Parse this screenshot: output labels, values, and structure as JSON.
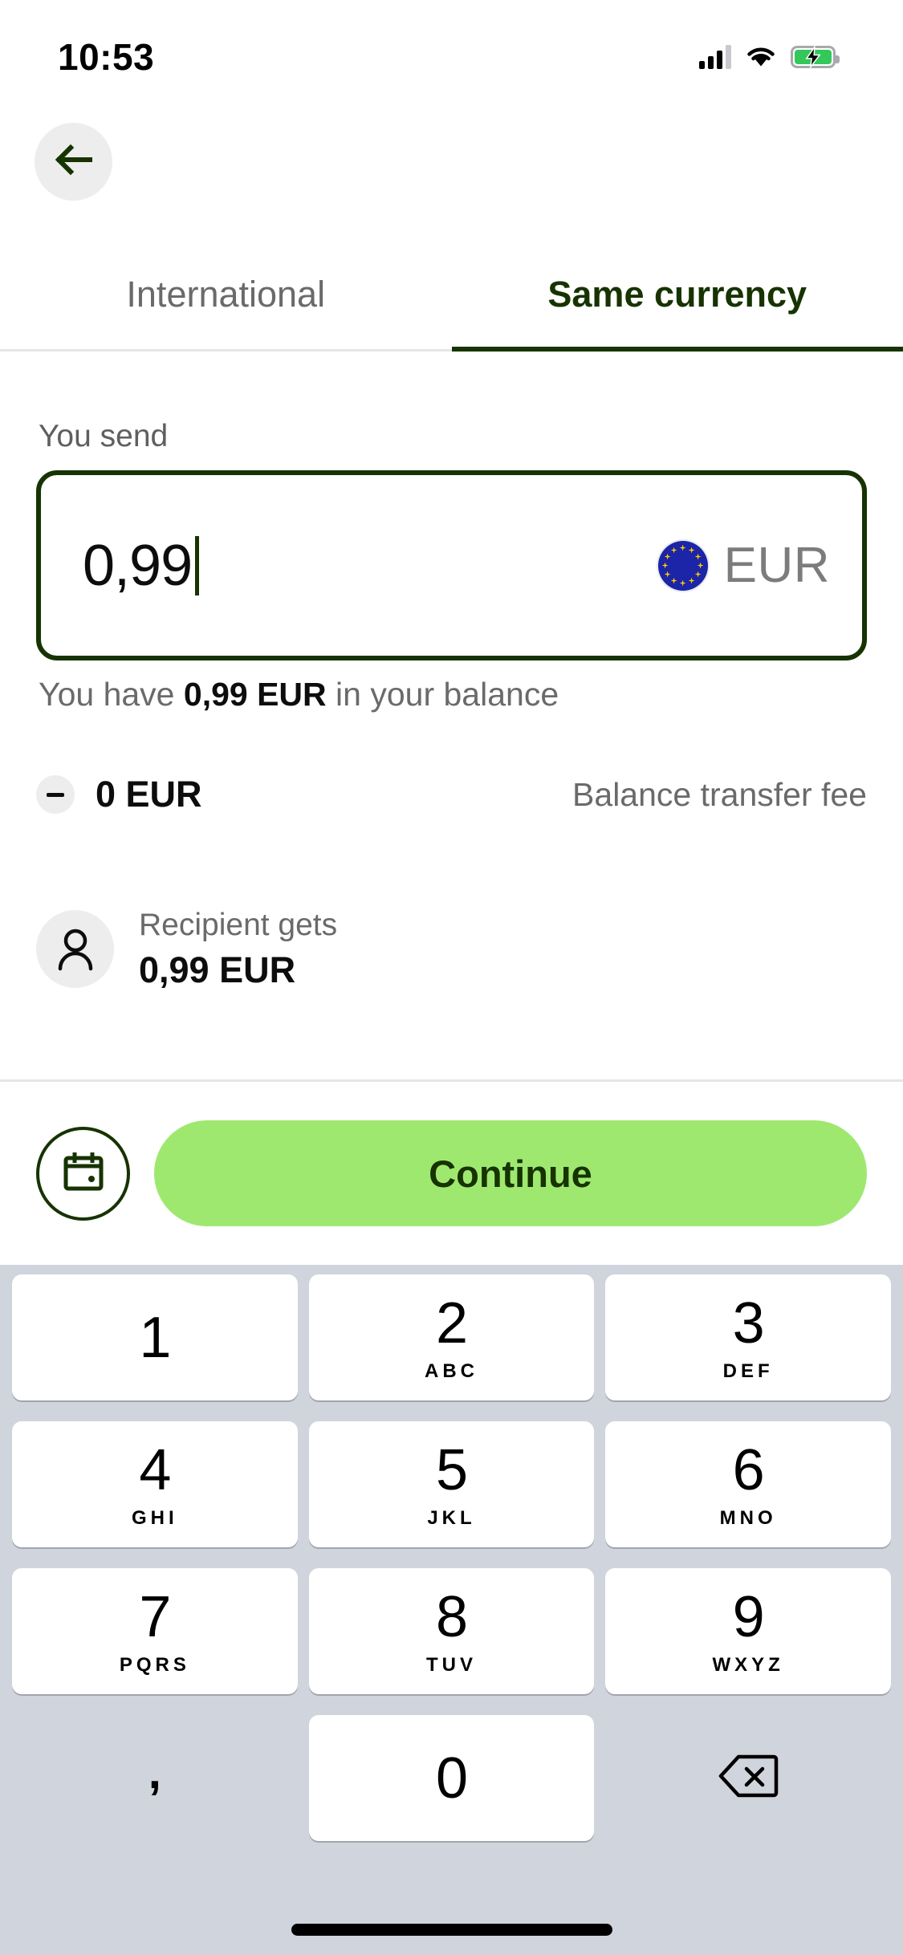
{
  "status_bar": {
    "time": "10:53",
    "signal_icon": "cellular-signal-icon",
    "wifi_icon": "wifi-icon",
    "battery_icon": "battery-charging-icon"
  },
  "header": {
    "back_icon": "back-arrow-icon"
  },
  "tabs": [
    {
      "label": "International",
      "active": false
    },
    {
      "label": "Same currency",
      "active": true
    }
  ],
  "send": {
    "label": "You send",
    "amount": "0,99",
    "currency_code": "EUR",
    "currency_flag": "eu-flag-icon",
    "balance_prefix": "You have ",
    "balance_amount": "0,99 EUR",
    "balance_suffix": " in your balance"
  },
  "fee": {
    "minus_icon": "minus-icon",
    "amount": "0 EUR",
    "caption": "Balance transfer fee"
  },
  "recipient": {
    "avatar_icon": "person-icon",
    "caption": "Recipient gets",
    "amount": "0,99 EUR"
  },
  "actions": {
    "schedule_icon": "calendar-icon",
    "continue_label": "Continue"
  },
  "keypad": {
    "rows": [
      [
        {
          "digit": "1",
          "letters": ""
        },
        {
          "digit": "2",
          "letters": "ABC"
        },
        {
          "digit": "3",
          "letters": "DEF"
        }
      ],
      [
        {
          "digit": "4",
          "letters": "GHI"
        },
        {
          "digit": "5",
          "letters": "JKL"
        },
        {
          "digit": "6",
          "letters": "MNO"
        }
      ],
      [
        {
          "digit": "7",
          "letters": "PQRS"
        },
        {
          "digit": "8",
          "letters": "TUV"
        },
        {
          "digit": "9",
          "letters": "WXYZ"
        }
      ]
    ],
    "comma": ",",
    "zero": "0",
    "backspace_icon": "backspace-icon"
  },
  "colors": {
    "brand_dark_green": "#163300",
    "brand_bright_green": "#9fe870",
    "muted_text": "#6a6a6a",
    "keyboard_bg": "#d0d4dc",
    "eu_blue": "#1c24a8",
    "eu_star_yellow": "#ffcc00"
  }
}
